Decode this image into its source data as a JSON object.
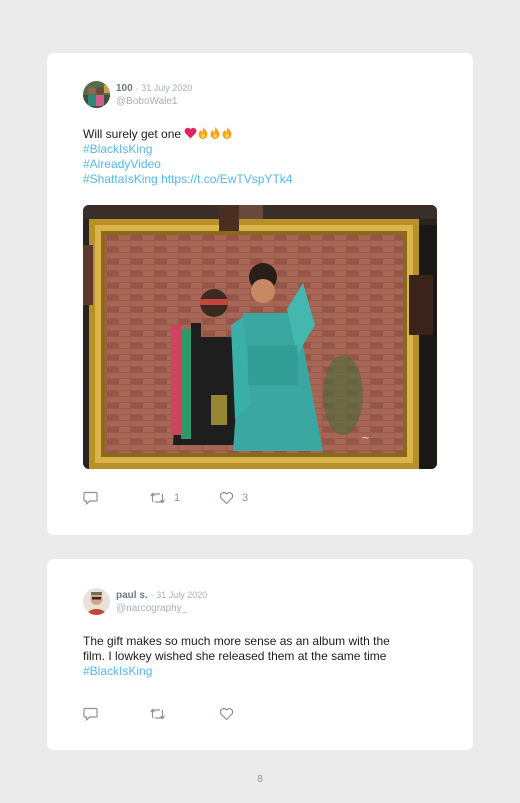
{
  "tweets": [
    {
      "name": "100",
      "separator": "·",
      "date": "31 July 2020",
      "handle": "@BoboWale1",
      "text": "Will surely get one",
      "emoji": [
        "heart",
        "fire",
        "fire",
        "fire"
      ],
      "hashtags": [
        "#BlackIsKing",
        "#AlreadyVideo",
        "#ShattaIsKing"
      ],
      "link": "https://t.co/EwTVspYTk4",
      "retweets": "1",
      "likes": "3"
    },
    {
      "name": "paul s.",
      "separator": "·",
      "date": "31 July 2020",
      "handle": "@narcography_",
      "text_line1": "The gift makes so much more sense as an album with the",
      "text_line2": "film. I lowkey wished she released them at the same time",
      "hashtags": [
        "#BlackIsKing"
      ],
      "retweets": "",
      "likes": ""
    }
  ],
  "page": {
    "number": "8"
  },
  "colors": {
    "background": "#ebebeb",
    "card": "#ffffff",
    "link": "#55b8e6",
    "name": "#6b7a86",
    "meta": "#a6b0b8",
    "heart": "#e0245e",
    "fire": "#f4a020"
  },
  "icons": [
    "reply-icon",
    "retweet-icon",
    "like-icon",
    "heart-emoji-icon",
    "fire-emoji-icon"
  ]
}
